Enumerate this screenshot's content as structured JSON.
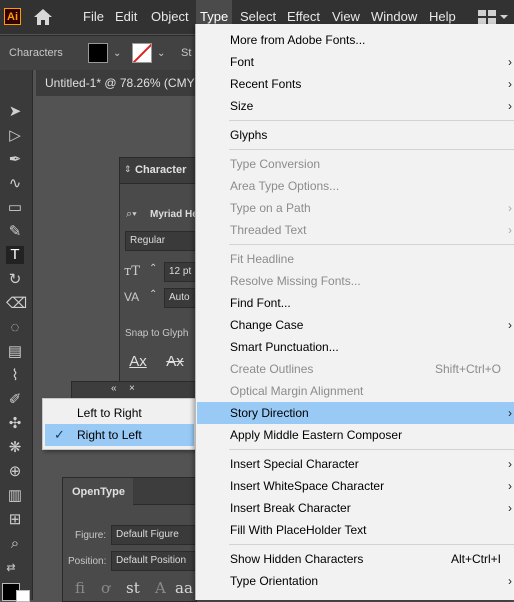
{
  "app": {
    "logo": "Ai"
  },
  "menubar": {
    "items": [
      "File",
      "Edit",
      "Object",
      "Type",
      "Select",
      "Effect",
      "View",
      "Window",
      "Help"
    ],
    "active": "Type"
  },
  "controlbar": {
    "panel_label": "Characters",
    "stroke_label_partial": "St"
  },
  "document": {
    "tab_title": "Untitled-1* @ 78.26% (CMYK"
  },
  "character_panel": {
    "title": "Character",
    "font_family": "Myriad He",
    "font_style": "Regular",
    "font_size": "12 pt",
    "tracking": "Auto",
    "snap_label": "Snap to Glyph",
    "glyph_btn_1": "Ax",
    "glyph_btn_2": "Ax"
  },
  "mini_panel": {
    "collapse": "«",
    "close": "×"
  },
  "opentype_panel": {
    "title": "OpenType",
    "figure_label": "Figure:",
    "figure_value": "Default Figure",
    "position_label": "Position:",
    "position_value": "Default Position",
    "glyphs": [
      "fi",
      "ơ",
      "st",
      "A",
      "aa"
    ]
  },
  "type_menu": {
    "groups": [
      [
        {
          "label": "More from Adobe Fonts...",
          "enabled": true
        },
        {
          "label": "Font",
          "enabled": true,
          "submenu": true
        },
        {
          "label": "Recent Fonts",
          "enabled": true,
          "submenu": true
        },
        {
          "label": "Size",
          "enabled": true,
          "submenu": true
        }
      ],
      [
        {
          "label": "Glyphs",
          "enabled": true
        }
      ],
      [
        {
          "label": "Type Conversion",
          "enabled": false
        },
        {
          "label": "Area Type Options...",
          "enabled": false
        },
        {
          "label": "Type on a Path",
          "enabled": false,
          "submenu": true
        },
        {
          "label": "Threaded Text",
          "enabled": false,
          "submenu": true
        }
      ],
      [
        {
          "label": "Fit Headline",
          "enabled": false
        },
        {
          "label": "Resolve Missing Fonts...",
          "enabled": false
        },
        {
          "label": "Find Font...",
          "enabled": true
        },
        {
          "label": "Change Case",
          "enabled": true,
          "submenu": true
        },
        {
          "label": "Smart Punctuation...",
          "enabled": true
        },
        {
          "label": "Create Outlines",
          "enabled": false,
          "shortcut": "Shift+Ctrl+O"
        },
        {
          "label": "Optical Margin Alignment",
          "enabled": false
        },
        {
          "label": "Story Direction",
          "enabled": true,
          "submenu": true,
          "highlighted": true
        },
        {
          "label": "Apply Middle Eastern Composer",
          "enabled": true
        }
      ],
      [
        {
          "label": "Insert Special Character",
          "enabled": true,
          "submenu": true
        },
        {
          "label": "Insert WhiteSpace Character",
          "enabled": true,
          "submenu": true
        },
        {
          "label": "Insert Break Character",
          "enabled": true,
          "submenu": true
        },
        {
          "label": "Fill With PlaceHolder Text",
          "enabled": true
        }
      ],
      [
        {
          "label": "Show Hidden Characters",
          "enabled": true,
          "shortcut": "Alt+Ctrl+I"
        },
        {
          "label": "Type Orientation",
          "enabled": true,
          "submenu": true
        }
      ]
    ]
  },
  "story_direction_submenu": {
    "items": [
      {
        "label": "Left to Right",
        "checked": false,
        "highlighted": false
      },
      {
        "label": "Right to Left",
        "checked": true,
        "highlighted": true
      }
    ]
  },
  "colors": {
    "menu_highlight": "#99c9f5",
    "menu_bg": "#f2f2f2",
    "chrome_dark": "#323232",
    "canvas": "#535353"
  }
}
